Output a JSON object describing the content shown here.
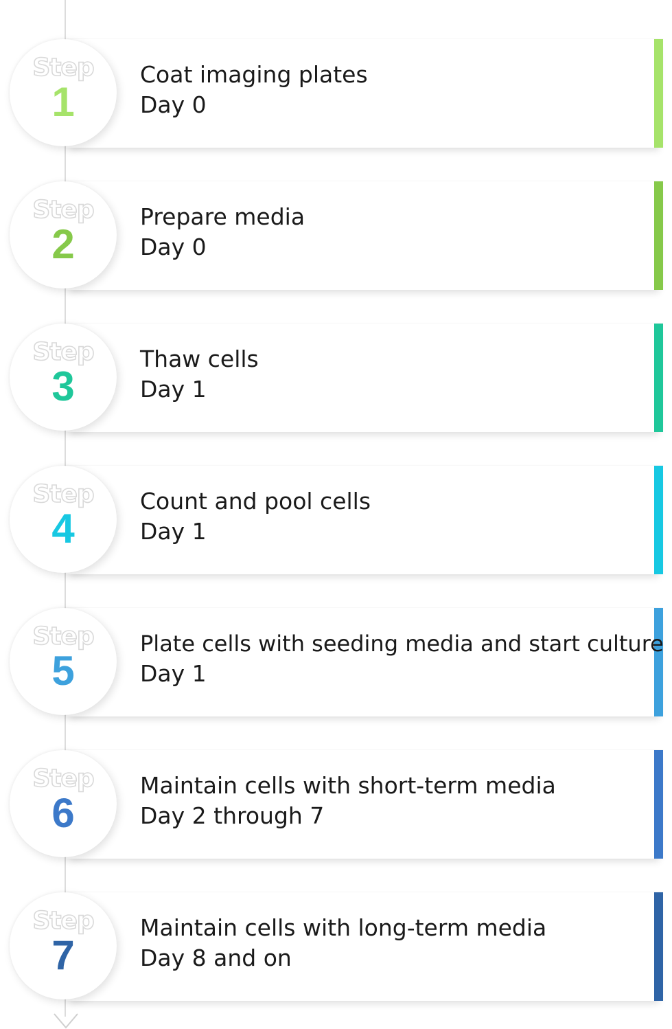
{
  "badge_word": "Step",
  "steps": [
    {
      "number": "1",
      "title": "Coat imaging plates",
      "day": "Day 0",
      "color": "#a6e36a"
    },
    {
      "number": "2",
      "title": "Prepare media",
      "day": "Day 0",
      "color": "#86c94a"
    },
    {
      "number": "3",
      "title": "Thaw cells",
      "day": "Day 1",
      "color": "#1fc79a"
    },
    {
      "number": "4",
      "title": "Count and pool cells",
      "day": "Day 1",
      "color": "#17c8e2"
    },
    {
      "number": "5",
      "title": "Plate cells with seeding media and start culture",
      "day": "Day 1",
      "color": "#3da1dd"
    },
    {
      "number": "6",
      "title": "Maintain cells with short-term media",
      "day": "Day 2 through 7",
      "color": "#3c79c9"
    },
    {
      "number": "7",
      "title": "Maintain cells with long-term media",
      "day": "Day 8 and on",
      "color": "#2f64a6"
    }
  ]
}
